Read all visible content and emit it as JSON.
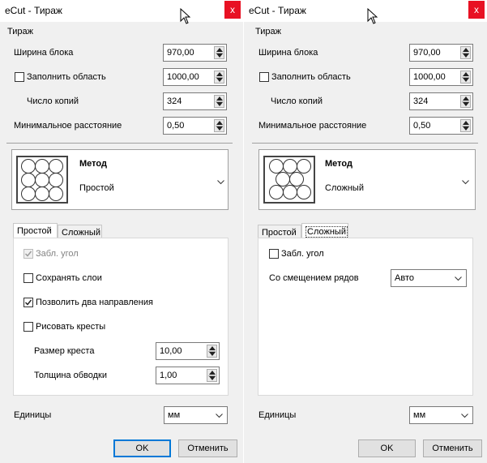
{
  "windows": [
    {
      "title": "eCut - Тираж",
      "close_glyph": "x",
      "group_title": "Тираж",
      "block_width": {
        "label": "Ширина блока",
        "value": "970,00"
      },
      "fill_area": {
        "label": "Заполнить область",
        "value": "1000,00",
        "checked": false
      },
      "copies": {
        "label": "Число копий",
        "value": "324"
      },
      "min_distance": {
        "label": "Минимальное расстояние",
        "value": "0,50"
      },
      "method": {
        "title": "Метод",
        "value": "Простой",
        "icon": "simple-grid-icon"
      },
      "tabs": [
        "Простой",
        "Сложный"
      ],
      "active_tab": 0,
      "simple_tab": {
        "blocked_corner": {
          "label": "Забл. угол",
          "checked": true,
          "disabled": true
        },
        "keep_layers": {
          "label": "Сохранять слои",
          "checked": false
        },
        "allow_two_directions": {
          "label": "Позволить два направления",
          "checked": true
        },
        "draw_crosses": {
          "label": "Рисовать кресты",
          "checked": false
        },
        "cross_size": {
          "label": "Размер креста",
          "value": "10,00"
        },
        "stroke_width": {
          "label": "Толщина обводки",
          "value": "1,00"
        }
      },
      "units": {
        "label": "Единицы",
        "value": "мм"
      },
      "ok_label": "OK",
      "cancel_label": "Отменить"
    },
    {
      "title": "eCut - Тираж",
      "close_glyph": "x",
      "group_title": "Тираж",
      "block_width": {
        "label": "Ширина блока",
        "value": "970,00"
      },
      "fill_area": {
        "label": "Заполнить область",
        "value": "1000,00",
        "checked": false
      },
      "copies": {
        "label": "Число копий",
        "value": "324"
      },
      "min_distance": {
        "label": "Минимальное расстояние",
        "value": "0,50"
      },
      "method": {
        "title": "Метод",
        "value": "Сложный",
        "icon": "complex-grid-icon"
      },
      "tabs": [
        "Простой",
        "Сложный"
      ],
      "active_tab": 1,
      "complex_tab": {
        "blocked_corner": {
          "label": "Забл. угол",
          "checked": false
        },
        "row_offset": {
          "label": "Со смещением рядов",
          "value": "Авто"
        }
      },
      "units": {
        "label": "Единицы",
        "value": "мм"
      },
      "ok_label": "OK",
      "cancel_label": "Отменить"
    }
  ],
  "colors": {
    "close": "#e81123",
    "default_button_border": "#0078d7",
    "window_bg": "#f0f0f0"
  }
}
